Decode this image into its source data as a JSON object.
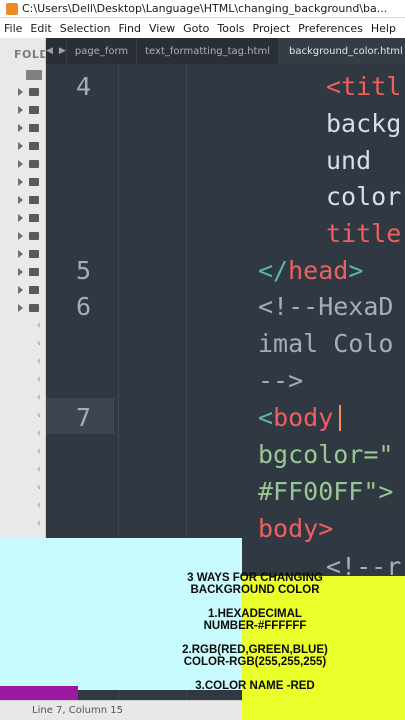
{
  "window": {
    "title": "C:\\Users\\Dell\\Desktop\\Language\\HTML\\changing_background\\ba..."
  },
  "menu": [
    "File",
    "Edit",
    "Selection",
    "Find",
    "View",
    "Goto",
    "Tools",
    "Project",
    "Preferences",
    "Help"
  ],
  "sidebar": {
    "header": "FOLD"
  },
  "tabs": [
    {
      "label": "page_form"
    },
    {
      "label": "text_formatting_tag.html"
    },
    {
      "label": "background_color.html",
      "active": true
    }
  ],
  "editor": {
    "line_numbers": [
      "4",
      "5",
      "6",
      "7"
    ],
    "lines": {
      "l4a": "<titl",
      "l4b": "backg",
      "l4c": "und",
      "l4d": "color",
      "l4e": "title",
      "l5_open": "</",
      "l5_tag": "head",
      "l5_close": ">",
      "l6a": "<!--HexaD",
      "l6b": "imal Colo",
      "l6c": "-->",
      "l7_open": "<",
      "l7_tag": "body",
      "l7b": "bgcolor=\"",
      "l7c": "#FF00FF\">",
      "l7d": "body>",
      "l8": "<!--r"
    }
  },
  "status": {
    "text": "Line 7, Column 15"
  },
  "overlay": {
    "title_line1": "3 WAYS FOR CHANGING",
    "title_line2": "BACKGROUND COLOR",
    "item1_line1": "1.HEXADECIMAL",
    "item1_line2": "NUMBER-#FFFFFF",
    "item2_line1": "2.RGB(RED,GREEN,BLUE)",
    "item2_line2": "COLOR-RGB(255,255,255)",
    "item3_line1": "3.COLOR NAME -RED"
  },
  "colors": {
    "editor_bg": "#303841",
    "tag": "#ee6060",
    "punctuation": "#5fb4b4",
    "cyan_overlay": "#c8fbfd",
    "yellow_overlay": "#eaff2a",
    "magenta_overlay": "#9c18a0"
  }
}
